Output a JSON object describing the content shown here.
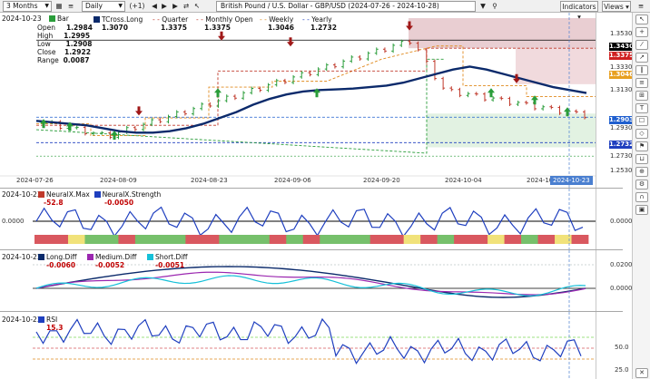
{
  "toolbar": {
    "timeframe": "3 Months",
    "interval": "Daily",
    "increment": "(+1)",
    "title": "British Pound / U.S. Dollar - GBP/USD (2024-07-26 - 2024-10-28)",
    "indicators_label": "Indicators",
    "views_label": "Views"
  },
  "price_panel": {
    "date": "2024-10-23",
    "bar_label": "Bar",
    "ohlc": [
      {
        "label": "Open",
        "value": "1.2984"
      },
      {
        "label": "High",
        "value": "1.2995"
      },
      {
        "label": "Low",
        "value": "1.2908"
      },
      {
        "label": "Close",
        "value": "1.2922"
      },
      {
        "label": "Range",
        "value": "0.0087"
      }
    ],
    "indicators": [
      {
        "label": "TCross.Long",
        "value": "1.3070",
        "color": "#0b2a6b"
      },
      {
        "label": "Quarter",
        "value": "1.3375",
        "color": "#c0392b"
      },
      {
        "label": "Monthly Open",
        "value": "1.3375",
        "color": "#c0392b"
      },
      {
        "label": "Weekly",
        "value": "1.3046",
        "color": "#e08a1e"
      },
      {
        "label": "Yearly",
        "value": "1.2732",
        "color": "#1f3fbf"
      }
    ],
    "price_boxes": [
      {
        "value": "1.3430",
        "color": "#000000"
      },
      {
        "value": "1.3375",
        "color": "#d02020"
      },
      {
        "value": "1.3046",
        "color": "#e8a020"
      },
      {
        "value": "1.2903",
        "color": "#1f5fcf"
      },
      {
        "value": "1.2732",
        "color": "#1f3fbf"
      }
    ],
    "y_ticks": [
      "1.3530",
      "1.3330",
      "1.3130",
      "1.2930",
      "1.2730",
      "1.2530"
    ]
  },
  "x_labels": [
    "2024-07-26",
    "2024-08-09",
    "2024-08-23",
    "2024-09-06",
    "2024-09-20",
    "2024-10-04",
    "2024-10"
  ],
  "current_date": "2024-10-23",
  "neural_panel": {
    "date": "2024-10-23",
    "items": [
      {
        "label": "NeuralX.Max",
        "value": "-52.8"
      },
      {
        "label": "NeuralX.Strength",
        "value": "-0.0050"
      }
    ],
    "y_ticks": [
      "0.0000"
    ]
  },
  "diff_panel": {
    "date": "2024-10-23",
    "items": [
      {
        "label": "Long.Diff",
        "value": "-0.0060",
        "color": "#0b2a6b"
      },
      {
        "label": "Medium.Diff",
        "value": "-0.0052",
        "color": "#9b27b0"
      },
      {
        "label": "Short.Diff",
        "value": "-0.0051",
        "color": "#16c0d8"
      }
    ],
    "y_ticks": [
      "0.0200",
      "0.0000"
    ]
  },
  "rsi_panel": {
    "date": "2024-10-23",
    "items": [
      {
        "label": "RSI",
        "value": "15.3"
      }
    ],
    "y_ticks": [
      "50.0",
      "25.0"
    ]
  },
  "chart_data": {
    "type": "line",
    "series": [
      {
        "name": "TCross.Long",
        "values": [
          1.288,
          1.287,
          1.286,
          1.285,
          1.283,
          1.281,
          1.28,
          1.28,
          1.281,
          1.283,
          1.286,
          1.29,
          1.294,
          1.299,
          1.303,
          1.306,
          1.308,
          1.309,
          1.3095,
          1.31,
          1.311,
          1.312,
          1.314,
          1.317,
          1.32,
          1.323,
          1.325,
          1.323,
          1.32,
          1.317,
          1.314,
          1.311,
          1.309,
          1.307
        ]
      },
      {
        "name": "Quarter",
        "values": [
          1.3375
        ]
      },
      {
        "name": "Monthly Open",
        "values": [
          1.3375
        ]
      },
      {
        "name": "Weekly",
        "values": [
          1.3046
        ]
      },
      {
        "name": "Yearly",
        "values": [
          1.2732
        ]
      }
    ],
    "ylim": [
      1.253,
      1.358
    ]
  }
}
